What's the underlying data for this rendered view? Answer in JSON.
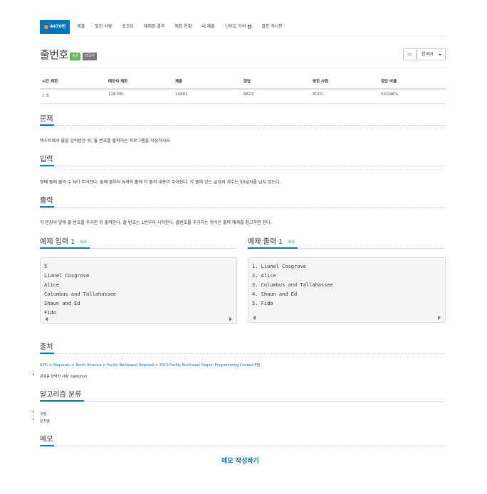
{
  "nav": {
    "items": [
      {
        "label": "4470번",
        "active": true
      },
      {
        "label": "제출"
      },
      {
        "label": "맞힌 사람"
      },
      {
        "label": "숏코딩"
      },
      {
        "label": "재채점 결과"
      },
      {
        "label": "채점 현황"
      },
      {
        "label": "내 제출"
      },
      {
        "label": "난이도 기여"
      },
      {
        "label": "질문 게시판"
      }
    ]
  },
  "problem": {
    "title": "줄번호",
    "badges": [
      "성공",
      "다국어"
    ],
    "star": "☆",
    "language": "한국어"
  },
  "stats": {
    "headers": [
      "시간 제한",
      "메모리 제한",
      "제출",
      "정답",
      "맞힌 사람",
      "정답 비율"
    ],
    "values": [
      "1 초",
      "128 MB",
      "14881",
      "8623",
      "8010",
      "59.946%"
    ]
  },
  "sections": {
    "problem_title": "문제",
    "problem_text": "텍스트에서 줄을 입력받은 뒤, 줄 번호를 출력하는 프로그램을 작성하시오.",
    "input_title": "입력",
    "input_text": "첫째 줄에 줄의 수 N이 주어진다. 둘째 줄부터 N개의 줄에 각 줄의 내용이 주어진다. 각 줄에 있는 글자의 개수는 50글자를 넘지 않는다.",
    "output_title": "출력",
    "output_text": "각 문장의 앞에 줄 번호를 추가한 뒤 출력한다. 줄 번호는 1번부터 시작한다. 줄번호를 추가하는 형식은 출력 예제를 참고하면 된다."
  },
  "sample_input": {
    "title": "예제 입력",
    "number": "1",
    "copy": "복사",
    "lines": [
      "5",
      "Lionel Cosgrove",
      "Alice",
      "Columbus and Tallahassee",
      "Shaun and Ed",
      "Fido"
    ]
  },
  "sample_output": {
    "title": "예제 출력",
    "number": "1",
    "copy": "복사",
    "lines": [
      "1. Lionel Cosgrove",
      "2. Alice",
      "3. Columbus and Tallahassee",
      "4. Shaun and Ed",
      "5. Fido"
    ]
  },
  "source": {
    "title": "출처",
    "breadcrumb": [
      "ICPC",
      "Regionals",
      "North America",
      "Pacific Northwest Regional",
      "2010 Pacific Northwest Region Programming Contest"
    ],
    "separator": " > ",
    "suffix": " F번",
    "translator_label": "문제를 번역한 사람:",
    "translator": "baekjoon"
  },
  "algorithm": {
    "title": "알고리즘 분류",
    "items": [
      "구현",
      "문자열"
    ]
  },
  "memo": {
    "title": "메모",
    "button": "메모 작성하기"
  }
}
